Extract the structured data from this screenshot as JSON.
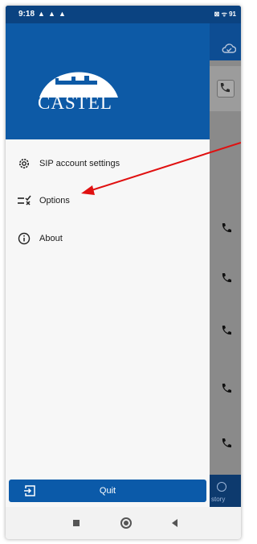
{
  "status_bar": {
    "time": "9:18",
    "warnings": [
      "▲",
      "▲",
      "▲"
    ],
    "right_indicators": "⊠ ᯤ 91"
  },
  "drawer": {
    "logo_text": "CASTEL",
    "menu": [
      {
        "label": "SIP account settings",
        "icon": "gear-icon"
      },
      {
        "label": "Options",
        "icon": "options-checklist-icon"
      },
      {
        "label": "About",
        "icon": "info-icon"
      }
    ],
    "quit_label": "Quit"
  },
  "background_app": {
    "bottom_tab_label": "story"
  },
  "colors": {
    "brand_blue": "#0d5aa6",
    "status_blue": "#0b4381",
    "arrow_red": "#e01010"
  }
}
